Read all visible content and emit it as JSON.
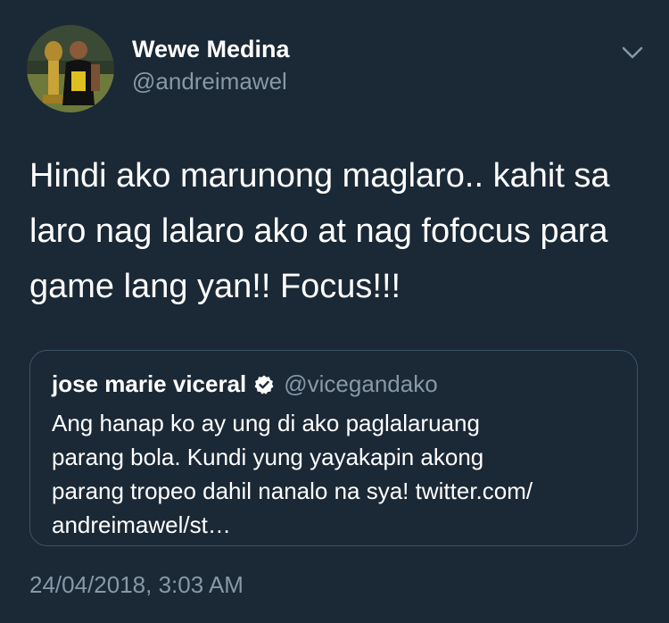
{
  "tweet": {
    "author": {
      "display_name": "Wewe Medina",
      "handle": "@andreimawel",
      "avatar_icon": "profile-photo"
    },
    "menu_icon": "chevron-down-icon",
    "text": "Hindi ako marunong maglaro.. kahit sa\nlaro nag lalaro ako at nag fofocus para\ngame lang yan!! Focus!!!",
    "quoted_tweet": {
      "display_name": "jose marie viceral",
      "verified_icon": "verified-badge-icon",
      "handle": "@vicegandako",
      "text": "Ang hanap ko ay ung di ako paglalaruang\nparang bola. Kundi yung yayakapin akong\nparang tropeo dahil nanalo na sya! twitter.com/\nandreimawel/st…"
    },
    "timestamp": "24/04/2018, 3:03 AM"
  },
  "colors": {
    "background": "#1b2836",
    "primary_text": "#ffffff",
    "secondary_text": "#8899a6",
    "card_border": "#3d5466"
  }
}
